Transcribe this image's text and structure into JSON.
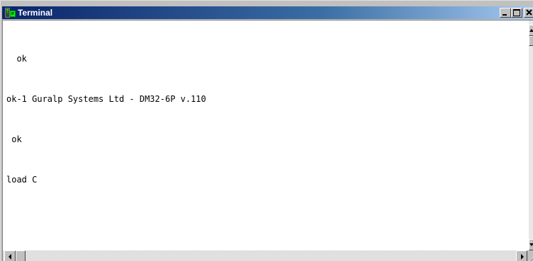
{
  "window": {
    "title": "Terminal",
    "buttons": [
      "minimize",
      "maximize",
      "close"
    ]
  },
  "terminal": {
    "lines": [
      "  ok",
      "ok-1 Guralp Systems Ltd - DM32-6P v.110",
      " ok",
      "load C"
    ]
  },
  "icons": {
    "app": "terminal-app-icon",
    "minimize": "minimize-icon",
    "maximize": "maximize-icon",
    "close": "close-icon"
  },
  "colors": {
    "title_bar_start": "#0a246a",
    "title_bar_end": "#a6caf0",
    "terminal_background": "#ffffff",
    "terminal_text": "#000000",
    "window_face": "#c0c0c0"
  }
}
